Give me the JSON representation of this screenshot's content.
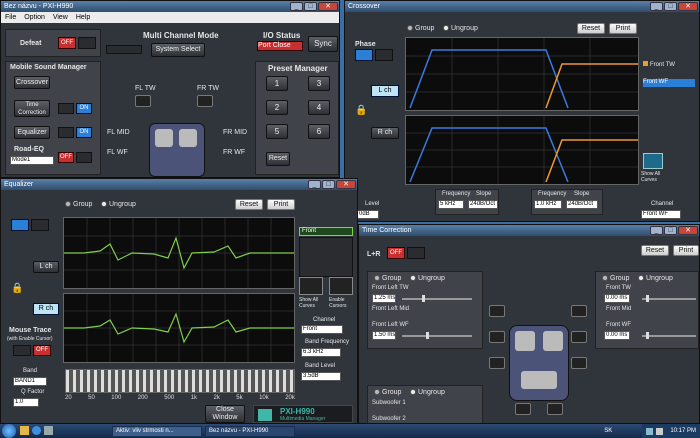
{
  "main_window": {
    "title": "Bez názvu - PXI-H990",
    "menu": [
      "File",
      "Option",
      "View",
      "Help"
    ],
    "defeat": {
      "label": "Defeat",
      "state": "OFF"
    },
    "multichannel": {
      "title": "Multi Channel Mode",
      "system_select": "System Select"
    },
    "io_status": {
      "title": "I/O Status",
      "port": "Port Close",
      "sync": "Sync"
    },
    "msm": {
      "title": "Mobile Sound Manager",
      "crossover": "Crossover",
      "time_correction": "Time Correction",
      "equalizer": "Equalizer",
      "road_eq": "Road-EQ",
      "road_eq_mode": "Mode1",
      "off": "OFF",
      "on": "ON"
    },
    "speakers": {
      "fl_tw": "FL TW",
      "fr_tw": "FR TW",
      "fl_mid": "FL MID",
      "fr_mid": "FR MID",
      "fl_wf": "FL WF",
      "fr_wf": "FR WF"
    },
    "preset": {
      "title": "Preset Manager",
      "buttons": [
        "1",
        "2",
        "3",
        "4",
        "5",
        "6"
      ],
      "reset": "Reset"
    }
  },
  "crossover": {
    "title": "Crossover",
    "group": "Group",
    "ungroup": "Ungroup",
    "reset": "Reset",
    "print": "Print",
    "phase": "Phase",
    "lch": "L ch",
    "rch": "R ch",
    "legend": [
      "Front TW",
      "Front WF"
    ],
    "show_all": "Show All Curves",
    "freq_label": "Frequency",
    "slope_label": "Slope",
    "level_label": "Level",
    "channel_label": "Channel",
    "freq1": "5 kHz",
    "slope1": "24dB/Oct",
    "freq2": "1.0 kHz",
    "slope2": "24dB/Oct",
    "level": "0dB",
    "channel": "Front WF"
  },
  "equalizer": {
    "title": "Equalizer",
    "group": "Group",
    "ungroup": "Ungroup",
    "reset": "Reset",
    "print": "Print",
    "lch": "L ch",
    "rch": "R ch",
    "legend": "Front",
    "show_all": "Show All Curves",
    "enable_cursors": "Enable Cursors",
    "mouse_trace": "Mouse Trace",
    "mouse_trace_sub": "(with Enable Cursor)",
    "channel_label": "Channel",
    "channel": "Front",
    "band_freq_label": "Band Frequency",
    "band_freq": "6.3 kHz",
    "band_level_label": "Band Level",
    "band_level": "3.5dB",
    "band_label": "Band",
    "band": "BAND1",
    "q_label": "Q Factor",
    "q": "1.0",
    "off": "OFF",
    "freq_ticks": [
      "20",
      "50",
      "100",
      "200",
      "500",
      "1k",
      "2k",
      "5k",
      "10k",
      "20k"
    ],
    "close": "Close Window",
    "logo": "PXI-H990",
    "logo_sub": "Multimedia Manager"
  },
  "time_correction": {
    "title": "Time Correction",
    "lr": "L+R",
    "off": "OFF",
    "reset": "Reset",
    "print": "Print",
    "group": "Group",
    "ungroup": "Ungroup",
    "front_left_tw": "Front Left TW",
    "front_left_mid": "Front Left Mid",
    "front_left_wf": "Front Left WF",
    "tw_val": "1.25 ms",
    "wf_val": "1.50 ms",
    "front_tw": "Front TW",
    "front_mid": "Front Mid",
    "front_wf": "Front WF",
    "r_tw_val": "0.00 ms",
    "r_wf_val": "0.00 ms",
    "subwoofer1": "Subwoofer 1",
    "subwoofer2": "Subwoofer 2"
  },
  "taskbar": {
    "items": [
      "Aktiv: vliv strmosti n...",
      "Bez názvu - PXI-H990"
    ],
    "lang": "SK",
    "time": "10:17 PM"
  }
}
